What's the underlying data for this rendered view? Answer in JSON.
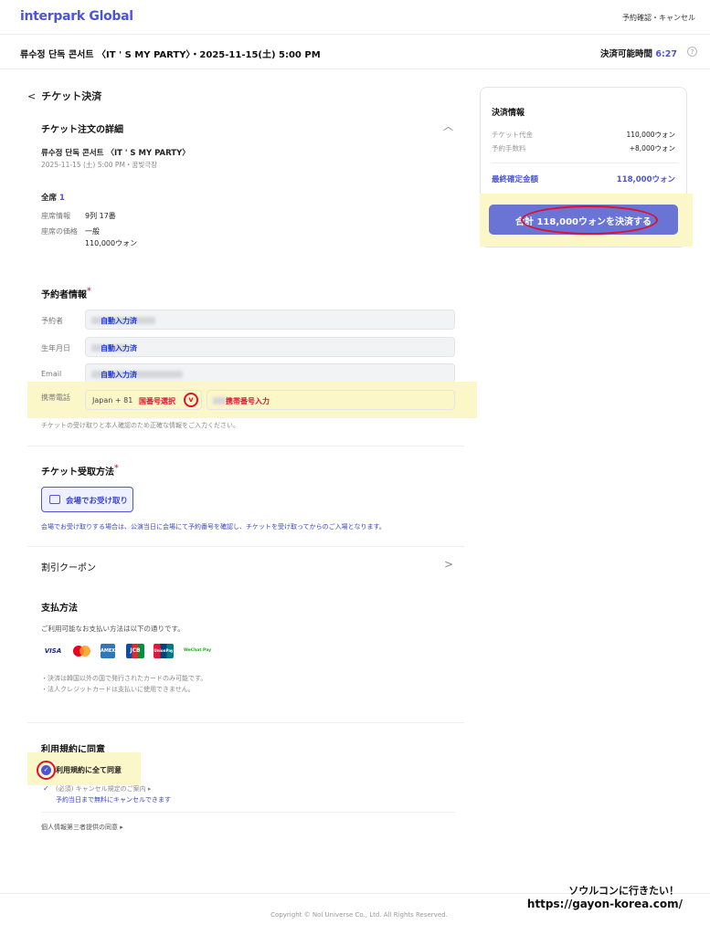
{
  "header": {
    "logo": "interpark Global",
    "top_link": "予約確認・キャンセル"
  },
  "event_bar": {
    "title": "류수정 단독 콘서트 〈IT ' S MY PARTY〉・2025-11-15(土) 5:00 PM",
    "timer_label": "決済可能時間",
    "timer_value": "6:27",
    "help": "?"
  },
  "page": {
    "back_label": "チケット決済"
  },
  "order": {
    "title": "チケット注文の詳細",
    "event_name": "류수정 단독 콘서트 〈IT ' S MY PARTY〉",
    "event_date": "2025-11-15 (土) 5:00 PM・꿈빛극장",
    "seat_class": "全席",
    "seat_count": "1",
    "seat_info_label": "座席情報",
    "seat_info_value": "9列 17番",
    "seat_price_label": "座席の価格",
    "seat_price_type": "一般",
    "seat_price_value": "110,000ウォン"
  },
  "booker": {
    "title": "予約者情報",
    "req": "*",
    "name_label": "予約者",
    "name_value": "自動入力済",
    "birth_label": "生年月日",
    "birth_value": "自動入力済",
    "email_label": "Email",
    "email_value": "自動入力済",
    "phone_label": "携帯電話",
    "phone_code": "Japan + 81",
    "phone_code_note": "国番号選択",
    "phone_number_note": "携帯番号入力",
    "notice": "チケットの受け取りと本人確認のため正確な情報をご入力ください。"
  },
  "pickup": {
    "title": "チケット受取方法",
    "req": "*",
    "option": "会場でお受け取り",
    "notice": "会場でお受け取りする場合は、公演当日に会場にて予約番号を確認し、チケットを受け取ってからのご入場となります。"
  },
  "coupon": {
    "title": "割引クーポン"
  },
  "payment": {
    "title": "支払方法",
    "desc": "ご利用可能なお支払い方法は以下の通りです。",
    "cards": [
      "VISA",
      "MC",
      "AMEX",
      "JCB",
      "UnionPay",
      "WeChat Pay"
    ],
    "note1": "・決済は韓国以外の国で発行されたカードのみ可能です。",
    "note2": "・法人クレジットカードは支払いに使用できません。"
  },
  "terms": {
    "title": "利用規約に同意",
    "agree_all": "利用規約に全て同意",
    "item1": "(必須) キャンセル規定のご案内 ▸",
    "item1_sub": "予約当日まで無料にキャンセルできます",
    "item2": "個人情報第三者提供の同意 ▸"
  },
  "summary": {
    "title": "決済情報",
    "ticket_label": "チケット代金",
    "ticket_value": "110,000ウォン",
    "fee_label": "予約手数料",
    "fee_value": "+8,000ウォン",
    "total_label": "最終確定金額",
    "total_value": "118,000ウォン",
    "pay_button": "合計 118,000ウォンを決済する"
  },
  "footer": {
    "copyright": "Copyright © Nol Universe Co., Ltd. All Rights Reserved.",
    "promo_line1": "ソウルコンに行きたい！",
    "promo_line2": "https://gayon-korea.com/"
  },
  "colors": {
    "accent": "#4b55d6",
    "highlight": "#fbf7c9",
    "annotation_red": "#e0102b"
  }
}
